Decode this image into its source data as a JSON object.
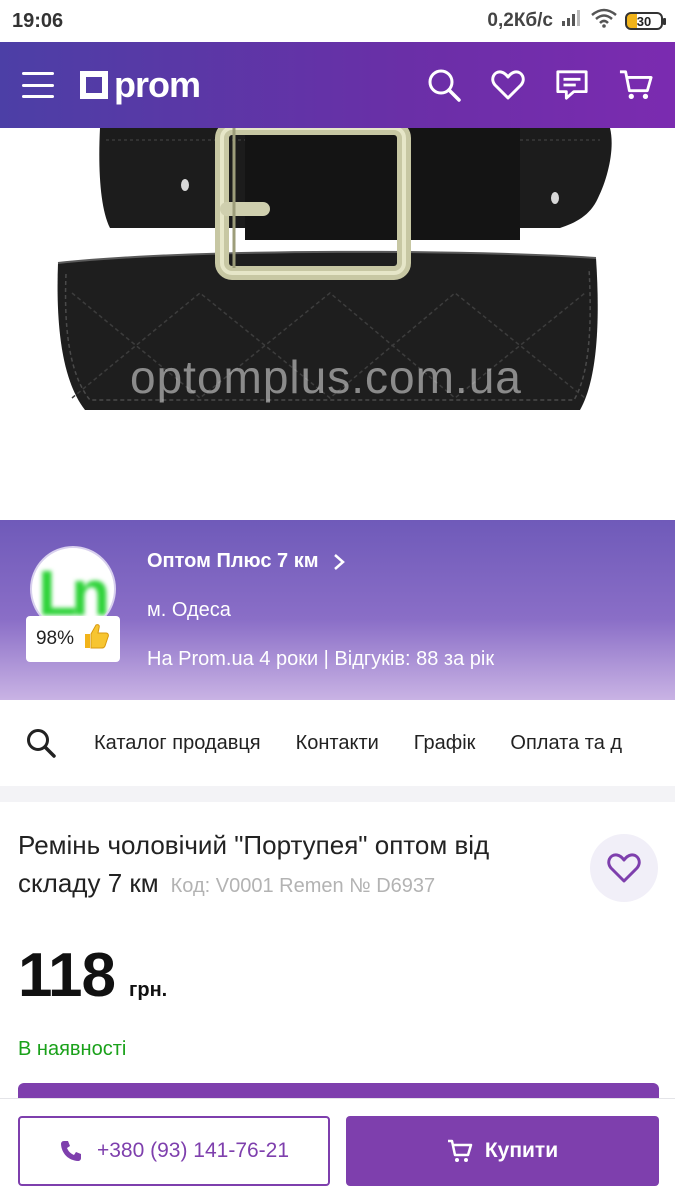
{
  "status_bar": {
    "time": "19:06",
    "network_speed": "0,2Кб/с",
    "battery": "30"
  },
  "header": {
    "logo_text": "prom",
    "icons": [
      "menu-icon",
      "search-icon",
      "heart-icon",
      "chat-icon",
      "cart-icon"
    ]
  },
  "product_image": {
    "watermark": "optomplus.com.ua"
  },
  "seller": {
    "name": "Оптом Плюс 7 км",
    "city": "м. Одеса",
    "meta": "На Prom.ua 4 роки | Відгуків: 88 за рік",
    "rating": "98%"
  },
  "seller_nav": {
    "items": [
      "Каталог продавця",
      "Контакти",
      "Графік",
      "Оплата та д"
    ]
  },
  "product": {
    "title": "Ремінь чоловічий \"Портупея\" оптом від складу 7 км",
    "code": "Код: V0001 Remen № D6937",
    "price": "118",
    "currency": "грн.",
    "availability": "В наявності"
  },
  "actions": {
    "phone": "+380 (93) 141-76-21",
    "buy_label": "Купити"
  },
  "colors": {
    "brand_purple": "#7e3fad",
    "header_gradient_start": "#4c3fa6",
    "in_stock_green": "#1aa11a"
  }
}
